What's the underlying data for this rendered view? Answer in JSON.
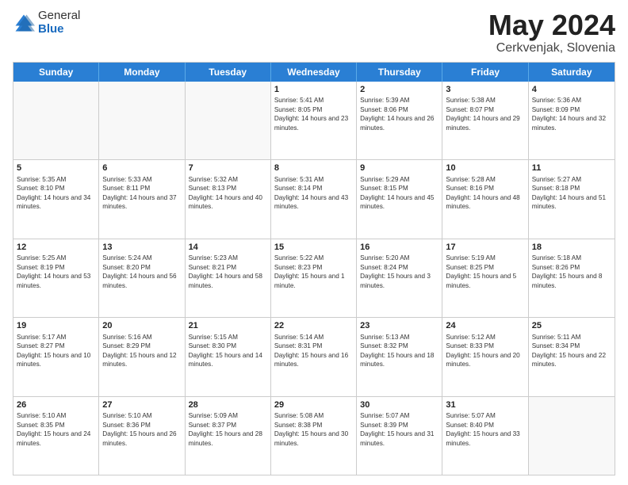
{
  "header": {
    "logo_general": "General",
    "logo_blue": "Blue",
    "title": "May 2024",
    "location": "Cerkvenjak, Slovenia"
  },
  "days_of_week": [
    "Sunday",
    "Monday",
    "Tuesday",
    "Wednesday",
    "Thursday",
    "Friday",
    "Saturday"
  ],
  "rows": [
    [
      {
        "day": "",
        "sunrise": "",
        "sunset": "",
        "daylight": "",
        "empty": true
      },
      {
        "day": "",
        "sunrise": "",
        "sunset": "",
        "daylight": "",
        "empty": true
      },
      {
        "day": "",
        "sunrise": "",
        "sunset": "",
        "daylight": "",
        "empty": true
      },
      {
        "day": "1",
        "sunrise": "Sunrise: 5:41 AM",
        "sunset": "Sunset: 8:05 PM",
        "daylight": "Daylight: 14 hours and 23 minutes."
      },
      {
        "day": "2",
        "sunrise": "Sunrise: 5:39 AM",
        "sunset": "Sunset: 8:06 PM",
        "daylight": "Daylight: 14 hours and 26 minutes."
      },
      {
        "day": "3",
        "sunrise": "Sunrise: 5:38 AM",
        "sunset": "Sunset: 8:07 PM",
        "daylight": "Daylight: 14 hours and 29 minutes."
      },
      {
        "day": "4",
        "sunrise": "Sunrise: 5:36 AM",
        "sunset": "Sunset: 8:09 PM",
        "daylight": "Daylight: 14 hours and 32 minutes."
      }
    ],
    [
      {
        "day": "5",
        "sunrise": "Sunrise: 5:35 AM",
        "sunset": "Sunset: 8:10 PM",
        "daylight": "Daylight: 14 hours and 34 minutes."
      },
      {
        "day": "6",
        "sunrise": "Sunrise: 5:33 AM",
        "sunset": "Sunset: 8:11 PM",
        "daylight": "Daylight: 14 hours and 37 minutes."
      },
      {
        "day": "7",
        "sunrise": "Sunrise: 5:32 AM",
        "sunset": "Sunset: 8:13 PM",
        "daylight": "Daylight: 14 hours and 40 minutes."
      },
      {
        "day": "8",
        "sunrise": "Sunrise: 5:31 AM",
        "sunset": "Sunset: 8:14 PM",
        "daylight": "Daylight: 14 hours and 43 minutes."
      },
      {
        "day": "9",
        "sunrise": "Sunrise: 5:29 AM",
        "sunset": "Sunset: 8:15 PM",
        "daylight": "Daylight: 14 hours and 45 minutes."
      },
      {
        "day": "10",
        "sunrise": "Sunrise: 5:28 AM",
        "sunset": "Sunset: 8:16 PM",
        "daylight": "Daylight: 14 hours and 48 minutes."
      },
      {
        "day": "11",
        "sunrise": "Sunrise: 5:27 AM",
        "sunset": "Sunset: 8:18 PM",
        "daylight": "Daylight: 14 hours and 51 minutes."
      }
    ],
    [
      {
        "day": "12",
        "sunrise": "Sunrise: 5:25 AM",
        "sunset": "Sunset: 8:19 PM",
        "daylight": "Daylight: 14 hours and 53 minutes."
      },
      {
        "day": "13",
        "sunrise": "Sunrise: 5:24 AM",
        "sunset": "Sunset: 8:20 PM",
        "daylight": "Daylight: 14 hours and 56 minutes."
      },
      {
        "day": "14",
        "sunrise": "Sunrise: 5:23 AM",
        "sunset": "Sunset: 8:21 PM",
        "daylight": "Daylight: 14 hours and 58 minutes."
      },
      {
        "day": "15",
        "sunrise": "Sunrise: 5:22 AM",
        "sunset": "Sunset: 8:23 PM",
        "daylight": "Daylight: 15 hours and 1 minute."
      },
      {
        "day": "16",
        "sunrise": "Sunrise: 5:20 AM",
        "sunset": "Sunset: 8:24 PM",
        "daylight": "Daylight: 15 hours and 3 minutes."
      },
      {
        "day": "17",
        "sunrise": "Sunrise: 5:19 AM",
        "sunset": "Sunset: 8:25 PM",
        "daylight": "Daylight: 15 hours and 5 minutes."
      },
      {
        "day": "18",
        "sunrise": "Sunrise: 5:18 AM",
        "sunset": "Sunset: 8:26 PM",
        "daylight": "Daylight: 15 hours and 8 minutes."
      }
    ],
    [
      {
        "day": "19",
        "sunrise": "Sunrise: 5:17 AM",
        "sunset": "Sunset: 8:27 PM",
        "daylight": "Daylight: 15 hours and 10 minutes."
      },
      {
        "day": "20",
        "sunrise": "Sunrise: 5:16 AM",
        "sunset": "Sunset: 8:29 PM",
        "daylight": "Daylight: 15 hours and 12 minutes."
      },
      {
        "day": "21",
        "sunrise": "Sunrise: 5:15 AM",
        "sunset": "Sunset: 8:30 PM",
        "daylight": "Daylight: 15 hours and 14 minutes."
      },
      {
        "day": "22",
        "sunrise": "Sunrise: 5:14 AM",
        "sunset": "Sunset: 8:31 PM",
        "daylight": "Daylight: 15 hours and 16 minutes."
      },
      {
        "day": "23",
        "sunrise": "Sunrise: 5:13 AM",
        "sunset": "Sunset: 8:32 PM",
        "daylight": "Daylight: 15 hours and 18 minutes."
      },
      {
        "day": "24",
        "sunrise": "Sunrise: 5:12 AM",
        "sunset": "Sunset: 8:33 PM",
        "daylight": "Daylight: 15 hours and 20 minutes."
      },
      {
        "day": "25",
        "sunrise": "Sunrise: 5:11 AM",
        "sunset": "Sunset: 8:34 PM",
        "daylight": "Daylight: 15 hours and 22 minutes."
      }
    ],
    [
      {
        "day": "26",
        "sunrise": "Sunrise: 5:10 AM",
        "sunset": "Sunset: 8:35 PM",
        "daylight": "Daylight: 15 hours and 24 minutes."
      },
      {
        "day": "27",
        "sunrise": "Sunrise: 5:10 AM",
        "sunset": "Sunset: 8:36 PM",
        "daylight": "Daylight: 15 hours and 26 minutes."
      },
      {
        "day": "28",
        "sunrise": "Sunrise: 5:09 AM",
        "sunset": "Sunset: 8:37 PM",
        "daylight": "Daylight: 15 hours and 28 minutes."
      },
      {
        "day": "29",
        "sunrise": "Sunrise: 5:08 AM",
        "sunset": "Sunset: 8:38 PM",
        "daylight": "Daylight: 15 hours and 30 minutes."
      },
      {
        "day": "30",
        "sunrise": "Sunrise: 5:07 AM",
        "sunset": "Sunset: 8:39 PM",
        "daylight": "Daylight: 15 hours and 31 minutes."
      },
      {
        "day": "31",
        "sunrise": "Sunrise: 5:07 AM",
        "sunset": "Sunset: 8:40 PM",
        "daylight": "Daylight: 15 hours and 33 minutes."
      },
      {
        "day": "",
        "sunrise": "",
        "sunset": "",
        "daylight": "",
        "empty": true
      }
    ]
  ]
}
